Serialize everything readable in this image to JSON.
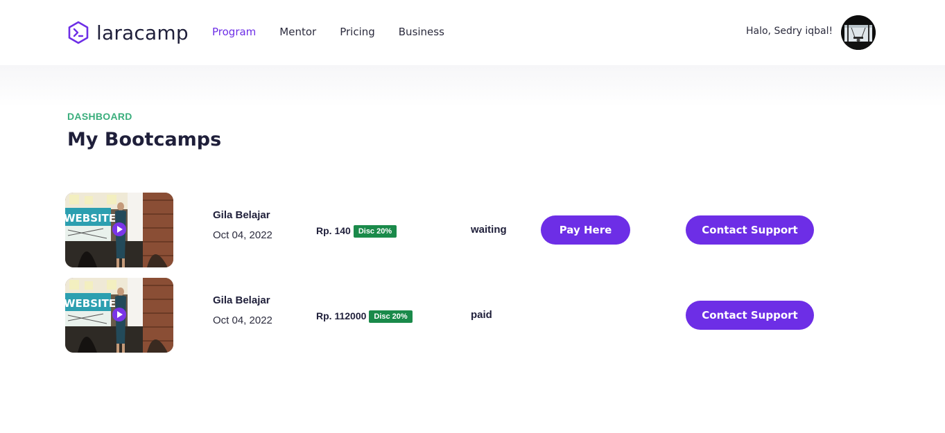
{
  "brand": {
    "name": "laracamp"
  },
  "nav": {
    "items": [
      {
        "label": "Program",
        "active": true
      },
      {
        "label": "Mentor",
        "active": false
      },
      {
        "label": "Pricing",
        "active": false
      },
      {
        "label": "Business",
        "active": false
      }
    ]
  },
  "user": {
    "greeting": "Halo, Sedry iqbal!"
  },
  "page": {
    "eyebrow": "DASHBOARD",
    "title": "My Bootcamps"
  },
  "bootcamps": [
    {
      "name": "Gila Belajar",
      "date": "Oct 04, 2022",
      "price": "Rp. 140",
      "discount": "Disc 20%",
      "status": "waiting",
      "pay_label": "Pay Here",
      "support_label": "Contact Support",
      "thumbnail_text": "WEBSITE"
    },
    {
      "name": "Gila Belajar",
      "date": "Oct 04, 2022",
      "price": "Rp. 112000",
      "discount": "Disc 20%",
      "status": "paid",
      "support_label": "Contact Support",
      "thumbnail_text": "WEBSITE"
    }
  ],
  "colors": {
    "primary": "#6d2ee6",
    "accent_green": "#3aae7c",
    "badge_green": "#1a8a4a",
    "text_dark": "#1f1f3a"
  }
}
